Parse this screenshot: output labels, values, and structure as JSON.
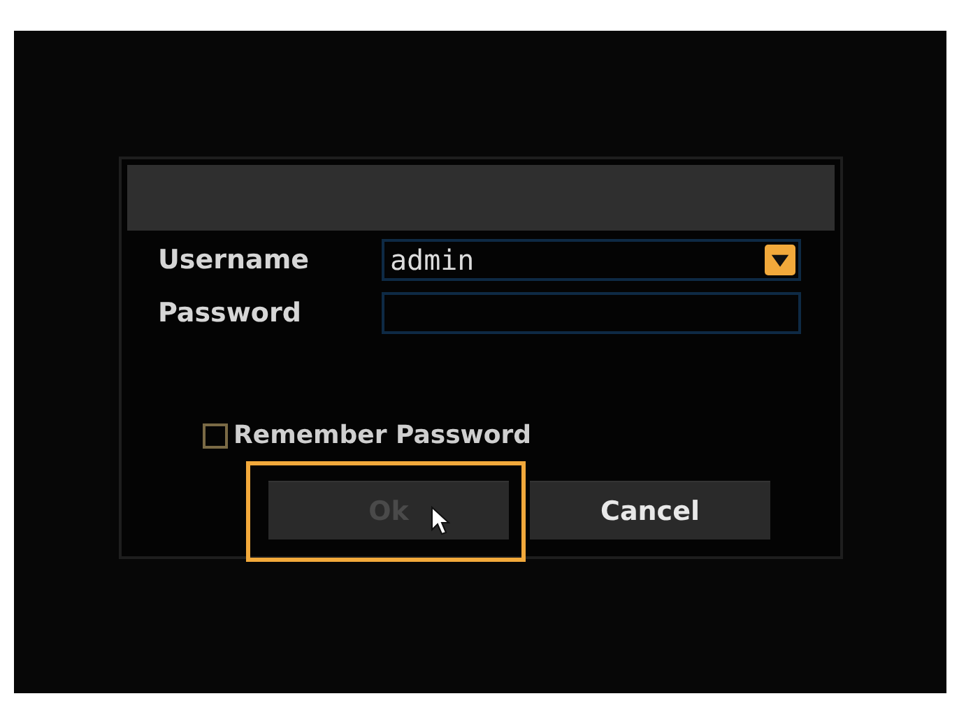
{
  "dialog": {
    "fields": [
      {
        "label": "Username",
        "kind": "dropdown",
        "value": "admin"
      },
      {
        "label": "Password",
        "kind": "password"
      }
    ],
    "remember": {
      "label": "Remember Password",
      "checked": false
    },
    "buttons": [
      {
        "label": "Ok",
        "disabled": true,
        "highlighted": true
      },
      {
        "label": "Cancel",
        "disabled": false,
        "highlighted": false
      }
    ]
  }
}
